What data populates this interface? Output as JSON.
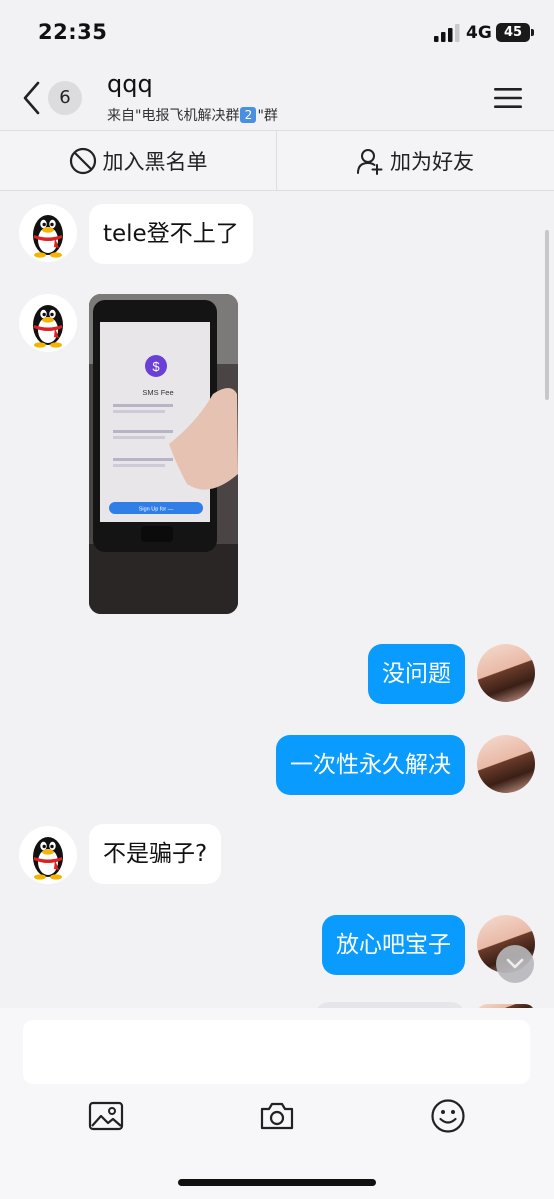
{
  "status_bar": {
    "time": "22:35",
    "network": "4G",
    "battery": "45"
  },
  "header": {
    "back_count": "6",
    "title": "qqq",
    "subtitle_prefix": "来自\"电报飞机解决群",
    "subtitle_emoji": "2",
    "subtitle_suffix": "\"群",
    "back_icon": "chevron-left-icon",
    "menu_icon": "menu-icon"
  },
  "actions": {
    "block_label": "加入黑名单",
    "add_friend_label": "加为好友"
  },
  "messages": [
    {
      "side": "in",
      "type": "text",
      "text": "tele登不上了"
    },
    {
      "side": "in",
      "type": "image",
      "image_text": "SMS Fee",
      "image_button": "Sign Up for —"
    },
    {
      "side": "out",
      "type": "text",
      "text": "没问题"
    },
    {
      "side": "out",
      "type": "text",
      "text": "一次性永久解决"
    },
    {
      "side": "in",
      "type": "text",
      "text": "不是骗子?"
    },
    {
      "side": "out",
      "type": "text",
      "text": "放心吧宝子"
    }
  ],
  "colors": {
    "outgoing_bubble": "#0a9bff",
    "incoming_bubble": "#ffffff",
    "background": "#f2f2f5"
  },
  "composer": {
    "input_value": "",
    "tools": [
      "image-icon",
      "camera-icon",
      "emoji-icon"
    ]
  }
}
